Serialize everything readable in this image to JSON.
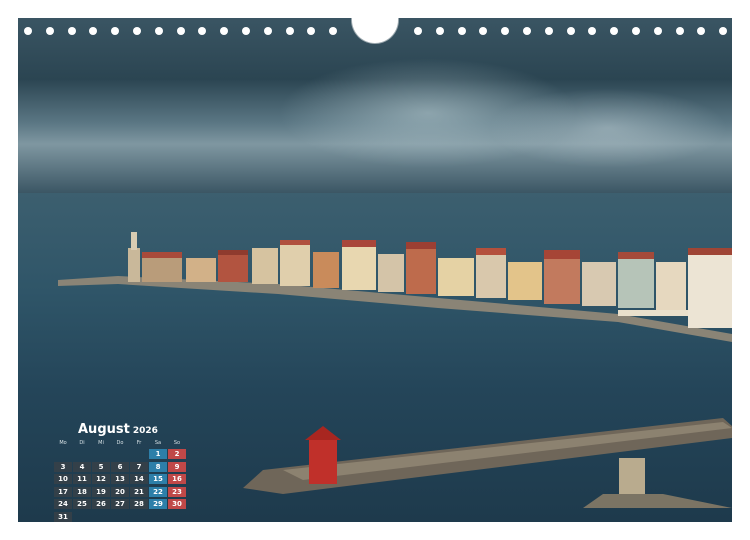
{
  "calendar": {
    "month": "August",
    "year": "2026",
    "weekdays": [
      "Mo",
      "Di",
      "Mi",
      "Do",
      "Fr",
      "Sa",
      "So"
    ],
    "days": [
      "1",
      "2",
      "3",
      "4",
      "5",
      "6",
      "7",
      "8",
      "9",
      "10",
      "11",
      "12",
      "13",
      "14",
      "15",
      "16",
      "17",
      "18",
      "19",
      "20",
      "21",
      "22",
      "23",
      "24",
      "25",
      "26",
      "27",
      "28",
      "29",
      "30",
      "31"
    ],
    "colors": {
      "saturday": "#2d7fa9",
      "sunday": "#c04848",
      "weekday": "#37414a"
    }
  },
  "photo": {
    "subject": "coastal-town-on-peninsula"
  }
}
